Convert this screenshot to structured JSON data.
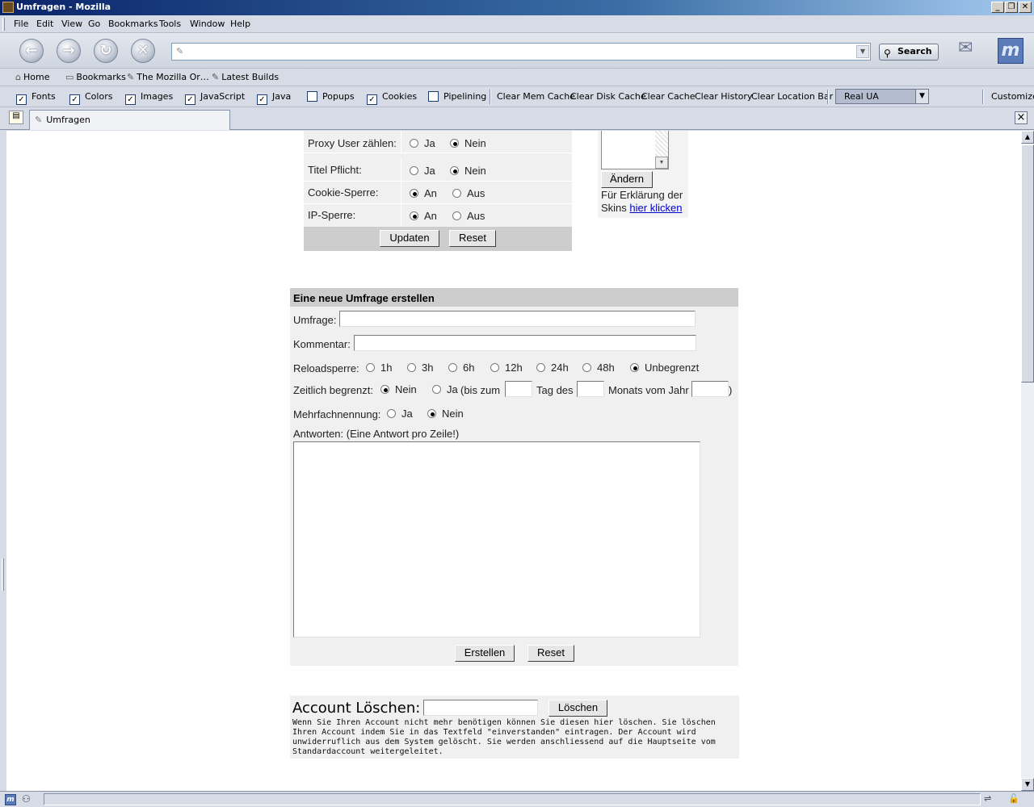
{
  "window": {
    "title": "Umfragen - Mozilla",
    "minimize": "_",
    "maximize": "❐",
    "close": "✕"
  },
  "menu": [
    "File",
    "Edit",
    "View",
    "Go",
    "Bookmarks",
    "Tools",
    "Window",
    "Help"
  ],
  "navigation": {
    "back_icon": "back-arrow-icon",
    "back_glyph": "←",
    "forward_glyph": "→",
    "reload_glyph": "↻",
    "stop_glyph": "✕",
    "url": "",
    "search_label": "Search"
  },
  "personal_toolbar": {
    "home": "Home",
    "bookmarks": "Bookmarks",
    "mozilla_org": "The Mozilla Or…",
    "latest_builds": "Latest Builds"
  },
  "prefbar": {
    "checks": [
      {
        "label": "Fonts",
        "checked": true
      },
      {
        "label": "Colors",
        "checked": true
      },
      {
        "label": "Images",
        "checked": true
      },
      {
        "label": "JavaScript",
        "checked": true
      },
      {
        "label": "Java",
        "checked": true
      },
      {
        "label": "Popups",
        "checked": false
      },
      {
        "label": "Cookies",
        "checked": true
      },
      {
        "label": "Pipelining",
        "checked": false
      }
    ],
    "buttons": [
      "Clear Mem Cache",
      "Clear Disk Cache",
      "Clear Cache",
      "Clear History",
      "Clear Location Bar"
    ],
    "ua_value": "Real UA",
    "customize": "Customize"
  },
  "tabs": {
    "active": "Umfragen"
  },
  "settings": {
    "rows": [
      {
        "label": "Proxy User zählen:",
        "opt1": "Ja",
        "opt2": "Nein",
        "selected": 2
      },
      {
        "label": "Titel Pflicht:",
        "opt1": "Ja",
        "opt2": "Nein",
        "selected": 2
      },
      {
        "label": "Cookie-Sperre:",
        "opt1": "An",
        "opt2": "Aus",
        "selected": 1
      },
      {
        "label": "IP-Sperre:",
        "opt1": "An",
        "opt2": "Aus",
        "selected": 1
      }
    ],
    "update_button": "Updaten",
    "reset_button": "Reset"
  },
  "skin": {
    "change_button": "Ändern",
    "explain_text": "Für Erklärung der Skins ",
    "link_text": "hier klicken"
  },
  "new_poll": {
    "header": "Eine neue Umfrage erstellen",
    "umfrage_label": "Umfrage:",
    "kommentar_label": "Kommentar:",
    "reload_label": "Reloadsperre:",
    "reload_options": [
      "1h",
      "3h",
      "6h",
      "12h",
      "24h",
      "48h",
      "Unbegrenzt"
    ],
    "reload_selected": "Unbegrenzt",
    "zeit_label": "Zeitlich begrenzt:",
    "zeit_nein": "Nein",
    "zeit_ja": "Ja",
    "bis_zum": "(bis zum",
    "tag_des": "Tag des",
    "monats_vom_jahr": "Monats vom Jahr",
    "close_paren": ")",
    "zeit_selected": "Nein",
    "mehrfach_label": "Mehrfachnennung:",
    "mehrfach_ja": "Ja",
    "mehrfach_nein": "Nein",
    "mehrfach_selected": "Nein",
    "antworten_label": "Antworten: (Eine Antwort pro Zeile!)",
    "create_button": "Erstellen",
    "reset_button": "Reset"
  },
  "account": {
    "title": "Account Löschen:",
    "delete_button": "Löschen",
    "description": "Wenn Sie Ihren Account nicht mehr benötigen können Sie diesen hier löschen. Sie löschen Ihren Account indem Sie in das Textfeld \"einverstanden\" eintragen. Der Account wird unwiderruflich aus dem System gelöscht. Sie werden anschliessend auf die Hauptseite vom Standardaccount weitergeleitet."
  }
}
